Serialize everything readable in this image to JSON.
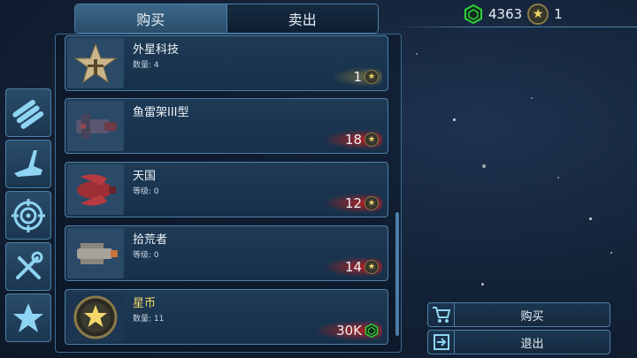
{
  "tabs": {
    "buy": "购买",
    "sell": "卖出"
  },
  "currency": {
    "gems": "4363",
    "stars": "1",
    "colors": {
      "gem": "#2fd13c",
      "star": "#f3d76a"
    }
  },
  "categories": [
    {
      "icon": "missiles-icon"
    },
    {
      "icon": "ship-wing-icon"
    },
    {
      "icon": "target-icon"
    },
    {
      "icon": "tools-icon"
    },
    {
      "icon": "star-icon"
    }
  ],
  "items": [
    {
      "name": "外星科技",
      "sub": "数量: 4",
      "price": "1",
      "currency": "star",
      "style": "gold",
      "icon": "alien-tech-badge-icon"
    },
    {
      "name": "鱼雷架III型",
      "sub": "",
      "price": "18",
      "currency": "star",
      "style": "red",
      "icon": "torpedo-launcher-icon"
    },
    {
      "name": "天国",
      "sub": "等级:  0",
      "price": "12",
      "currency": "star",
      "style": "red",
      "icon": "red-ship-icon"
    },
    {
      "name": "拾荒者",
      "sub": "等级:  0",
      "price": "14",
      "currency": "star",
      "style": "red",
      "icon": "scavenger-ship-icon"
    },
    {
      "name": "星币",
      "sub": "数量: 11",
      "price": "30K",
      "currency": "gem",
      "style": "red",
      "icon": "star-coin-icon"
    }
  ],
  "actions": {
    "buy": "购买",
    "exit": "退出"
  }
}
